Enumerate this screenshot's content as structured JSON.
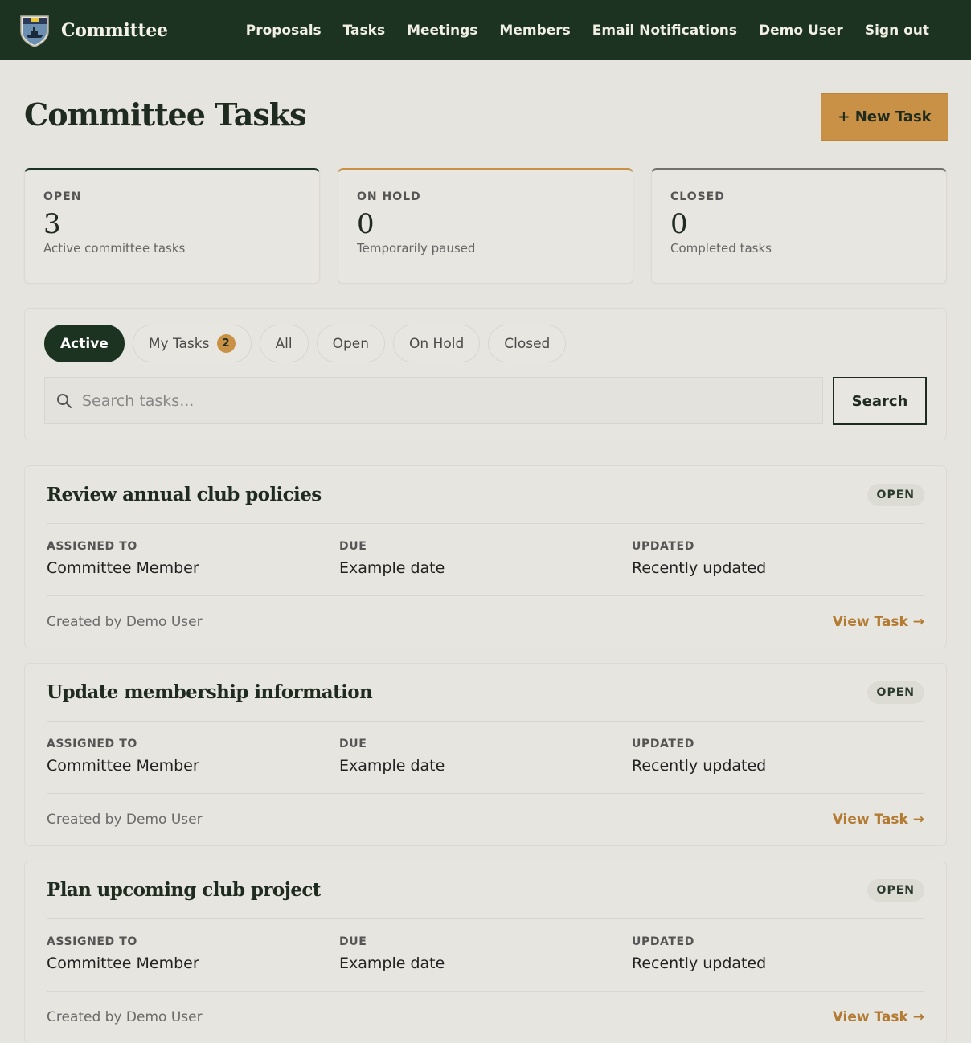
{
  "app": {
    "name": "Committee",
    "colors": {
      "primary": "#1b3320",
      "accent": "#c99145",
      "background": "#e6e4df"
    }
  },
  "nav": {
    "items": [
      "Proposals",
      "Tasks",
      "Meetings",
      "Members",
      "Email Notifications",
      "Demo User",
      "Sign out"
    ]
  },
  "page": {
    "title": "Committee Tasks",
    "new_task_label": "+ New Task"
  },
  "stats": [
    {
      "label": "OPEN",
      "value": "3",
      "sub": "Active committee tasks"
    },
    {
      "label": "ON HOLD",
      "value": "0",
      "sub": "Temporarily paused"
    },
    {
      "label": "CLOSED",
      "value": "0",
      "sub": "Completed tasks"
    }
  ],
  "filters": {
    "tabs": [
      "Active",
      "My Tasks",
      "All",
      "Open",
      "On Hold",
      "Closed"
    ],
    "active_tab": "Active",
    "my_tasks_count": "2"
  },
  "search": {
    "placeholder": "Search tasks...",
    "button_label": "Search",
    "icon": "search-icon"
  },
  "task_labels": {
    "assigned": "ASSIGNED TO",
    "due": "DUE",
    "updated": "UPDATED",
    "view": "View Task →"
  },
  "tasks": [
    {
      "title": "Review annual club policies",
      "status": "OPEN",
      "assigned": "Committee Member",
      "due": "Example date",
      "updated": "Recently updated",
      "created": "Created by Demo User"
    },
    {
      "title": "Update membership information",
      "status": "OPEN",
      "assigned": "Committee Member",
      "due": "Example date",
      "updated": "Recently updated",
      "created": "Created by Demo User"
    },
    {
      "title": "Plan upcoming club project",
      "status": "OPEN",
      "assigned": "Committee Member",
      "due": "Example date",
      "updated": "Recently updated",
      "created": "Created by Demo User"
    }
  ]
}
